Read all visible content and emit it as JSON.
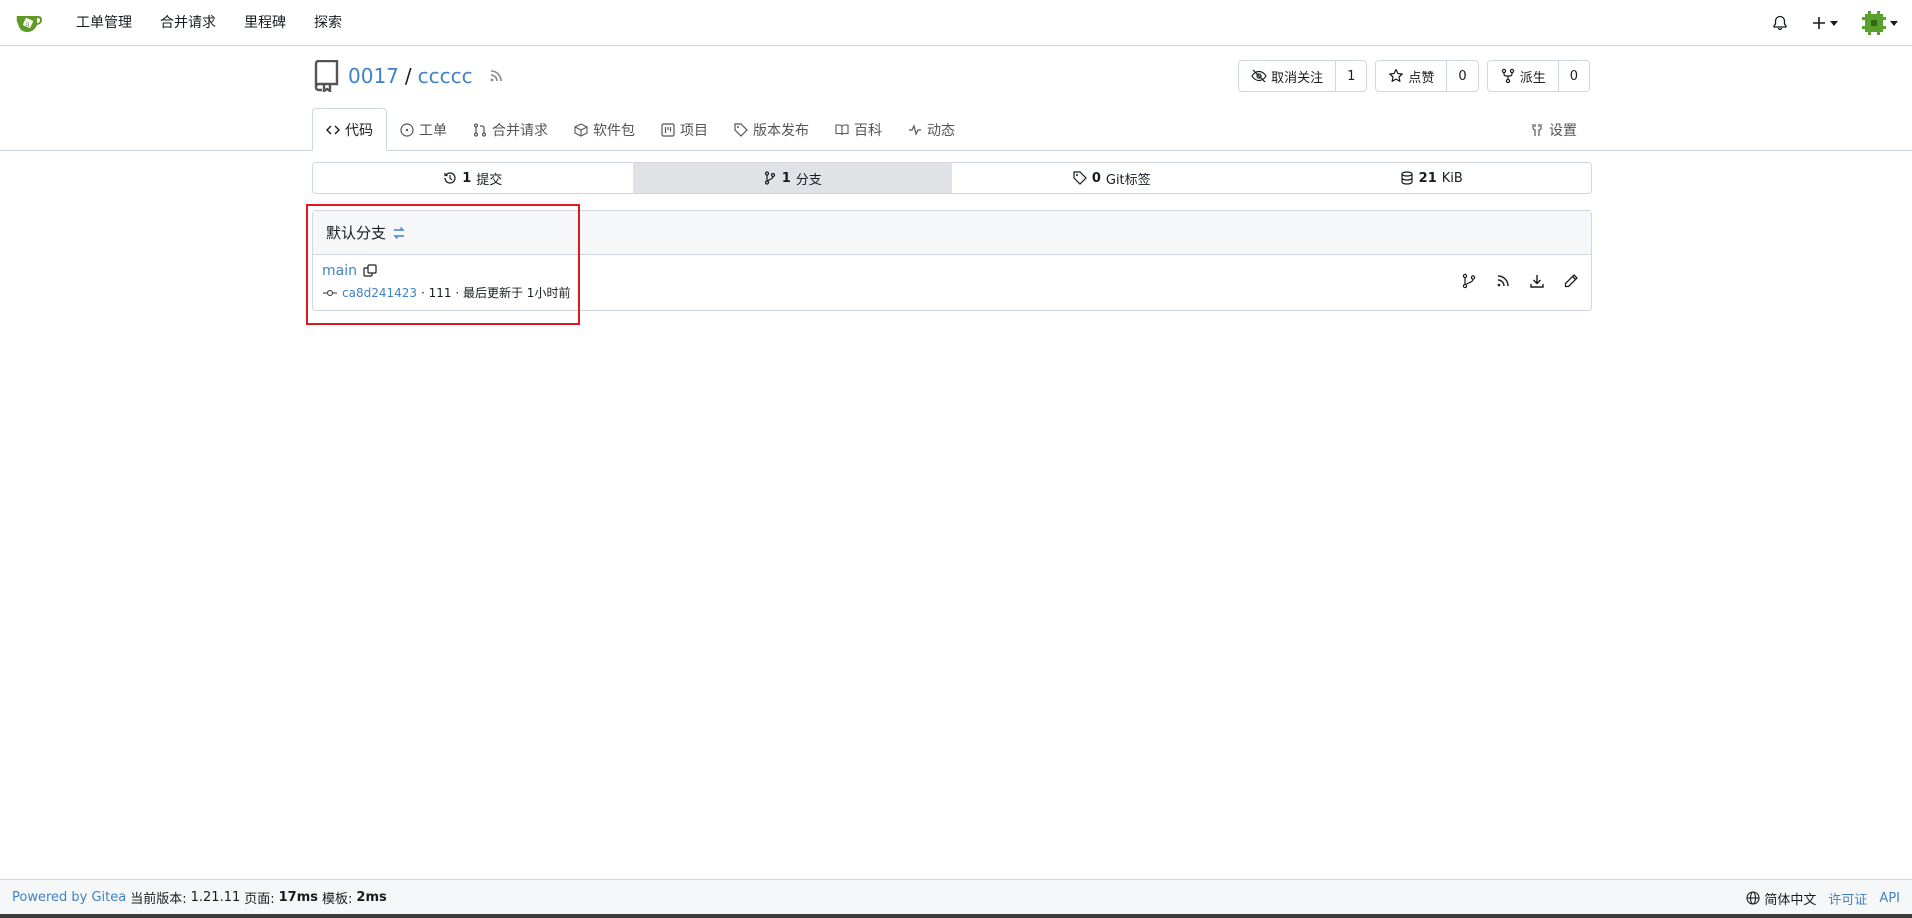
{
  "nav": {
    "items": [
      "工单管理",
      "合并请求",
      "里程碑",
      "探索"
    ]
  },
  "repo": {
    "owner": "0017",
    "separator": "/",
    "name": "ccccc",
    "watch_label": "取消关注",
    "watch_count": "1",
    "star_label": "点赞",
    "star_count": "0",
    "fork_label": "派生",
    "fork_count": "0"
  },
  "tabs": {
    "code": "代码",
    "issues": "工单",
    "pulls": "合并请求",
    "packages": "软件包",
    "projects": "项目",
    "releases": "版本发布",
    "wiki": "百科",
    "activity": "动态",
    "settings": "设置"
  },
  "stats": {
    "commits_count": "1",
    "commits_label": "提交",
    "branches_count": "1",
    "branches_label": "分支",
    "tags_count": "0",
    "tags_label": "Git标签",
    "size_value": "21",
    "size_unit": "KiB"
  },
  "branch_panel": {
    "heading": "默认分支",
    "branch_name": "main",
    "commit_sha": "ca8d241423",
    "commit_message": "· 111 · 最后更新于 1小时前"
  },
  "footer": {
    "powered_by": "Powered by Gitea",
    "version_label": "当前版本:",
    "version": "1.21.11",
    "page_label": "页面:",
    "page_time": "17ms",
    "template_label": "模板:",
    "template_time": "2ms",
    "language": "简体中文",
    "license": "许可证",
    "api": "API"
  },
  "colors": {
    "link": "#4183c4",
    "logo_green": "#609926",
    "highlight": "#e0191f"
  }
}
